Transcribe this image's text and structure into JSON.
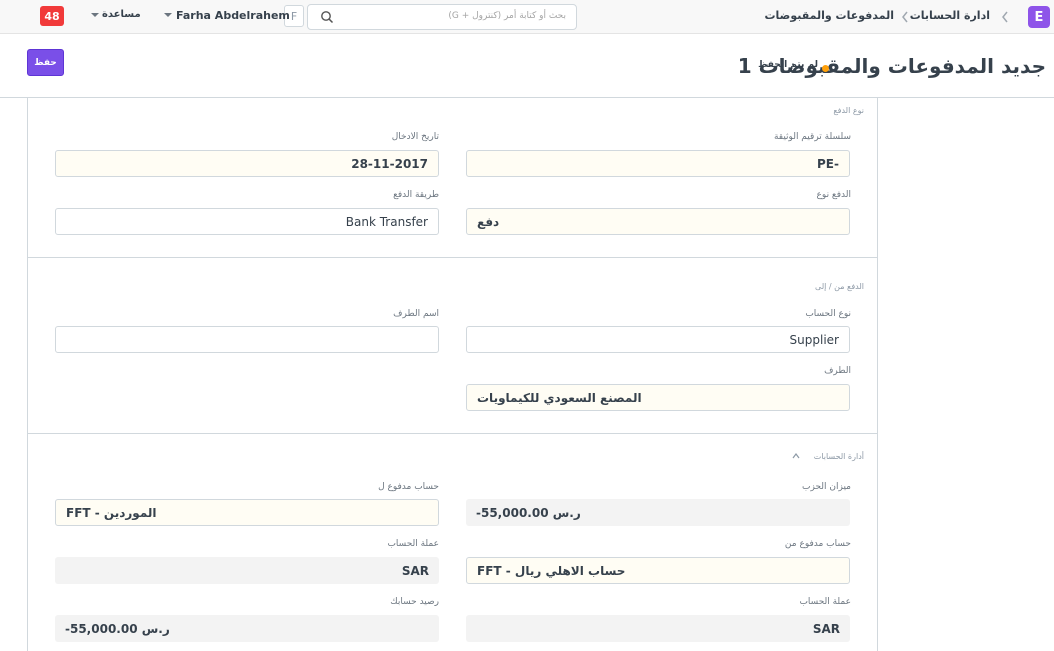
{
  "navbar": {
    "app_logo": "E",
    "breadcrumbs": [
      "ادارة الحسابات",
      "المدفوعات والمقبوضات"
    ],
    "search_placeholder": "بحث أو كتابة أمر (كنترول + G)",
    "avatar_initial": "F",
    "user_name": "Farha Abdelrahem",
    "help_label": "مساعدة",
    "notification_count": "48"
  },
  "page_head": {
    "title": "جديد المدفوعات والمقبوضات 1",
    "status": "لم يتم الحفظ",
    "save_label": "حفظ"
  },
  "colors": {
    "brand": "#8e54e9",
    "primary_button": "#7a4fe8",
    "unsaved_indicator": "#ffa00a",
    "notification": "#f13a3a",
    "mandatory_field_bg": "#fffdf4"
  },
  "form": {
    "section_payment_type": {
      "heading": "نوع الدفع",
      "naming_series_label": "سلسلة ترقيم الوثيقة",
      "naming_series_value": "PE-",
      "posting_date_label": "تاريخ الادخال",
      "posting_date_value": "28-11-2017",
      "payment_type_label": "الدفع نوع",
      "payment_type_value": "دفع",
      "mode_of_payment_label": "طريقة الدفع",
      "mode_of_payment_value": "Bank Transfer"
    },
    "section_party": {
      "heading": "الدفع من / إلى",
      "party_type_label": "نوع الحساب",
      "party_type_value": "Supplier",
      "party_name_label": "اسم الطرف",
      "party_name_value": "",
      "party_label": "الطرف",
      "party_value": "المصنع السعودي للكيماويات"
    },
    "section_accounts": {
      "heading": "أدارة الحسابات",
      "party_balance_label": "ميزان الحزب",
      "party_balance_value": "ر.س 55,000.00-",
      "paid_to_label": "حساب مدفوع ل",
      "paid_to_value": "الموردين - FFT",
      "paid_from_label": "حساب مدفوع من",
      "paid_from_value": "حساب الاهلي ريال - FFT",
      "paid_to_currency_label": "عملة الحساب",
      "paid_to_currency_value": "SAR",
      "paid_from_currency_label": "عملة الحساب",
      "paid_from_currency_value": "SAR",
      "account_balance_label": "رصيد حسابك",
      "account_balance_value": "ر.س 55,000.00-"
    }
  }
}
